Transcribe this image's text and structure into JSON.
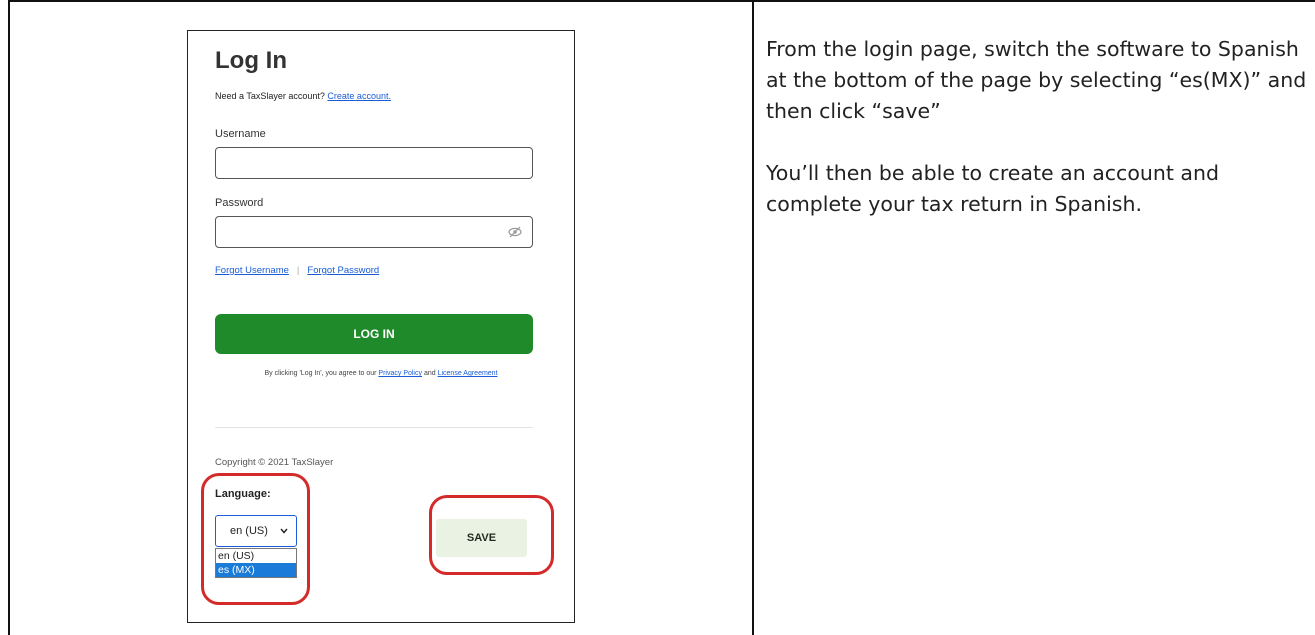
{
  "login": {
    "title": "Log In",
    "need_account_text": "Need a TaxSlayer account?",
    "create_account_link": "Create account.",
    "username_label": "Username",
    "username_value": "",
    "password_label": "Password",
    "password_value": "",
    "forgot_username": "Forgot Username",
    "separator": "|",
    "forgot_password": "Forgot Password",
    "login_button": "LOG IN",
    "agree_prefix": "By clicking 'Log In', you agree to our",
    "privacy_link": "Privacy Policy",
    "agree_and": "and",
    "license_link": "License Agreement",
    "copyright": "Copyright © 2021 TaxSlayer",
    "language_label": "Language:",
    "language_selected": "en (US)",
    "language_options": [
      "en (US)",
      "es (MX)"
    ],
    "highlighted_option": "es (MX)",
    "save_button": "SAVE"
  },
  "instructions": {
    "paragraph1": "From the login page, switch the software to Spanish at the bottom of the page by selecting “es(MX)” and then click “save”",
    "paragraph2": "You’ll then be able to create an account and complete your tax return in Spanish."
  },
  "colors": {
    "login_button": "#1f8a2a",
    "link": "#1a5cd6",
    "highlight_ring": "#d42a2a",
    "selected_option": "#1a7bd8",
    "save_button_bg": "#eaf3e3"
  }
}
